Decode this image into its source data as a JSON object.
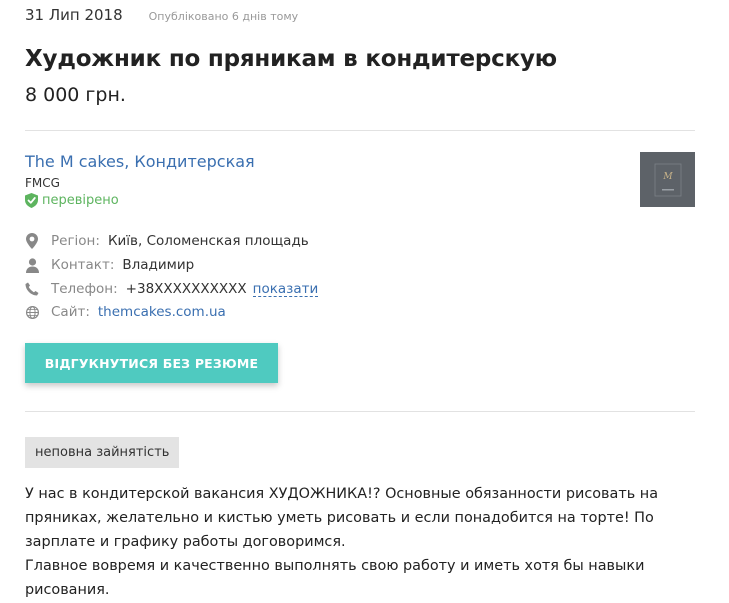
{
  "header": {
    "date": "31 Лип 2018",
    "published": "Опубліковано 6 днів тому",
    "title": "Художник по пряникам в кондитерскую",
    "salary": "8 000 грн."
  },
  "company": {
    "name": "The M cakes, Кондитерская",
    "sector": "FMCG",
    "verified_label": "перевірено",
    "logo_icon": "company-logo"
  },
  "details": {
    "region_label": "Регіон:",
    "region_value": "Київ, Соломенская площадь",
    "contact_label": "Контакт:",
    "contact_value": "Владимир",
    "phone_label": "Телефон:",
    "phone_value": "+38XXXXXXXXXX",
    "phone_show": "показати",
    "site_label": "Сайт:",
    "site_value": "themcakes.com.ua"
  },
  "actions": {
    "apply_label": "ВІДГУКНУТИСЯ БЕЗ РЕЗЮМЕ"
  },
  "tags": {
    "employment": "неповна зайнятість"
  },
  "description": {
    "paragraph1": "У нас в кондитерской вакансия ХУДОЖНИКА!? Основные обязанности рисовать на пряниках, желательно и кистью уметь рисовать и если понадобится на торте! По зарплате и графику работы договоримся.",
    "paragraph2": "Главное вовремя и качественно выполнять свою работу и иметь хотя бы навыки рисования."
  },
  "colors": {
    "accent": "#4fcac0",
    "link": "#3a6fb0",
    "verified": "#5db45f"
  }
}
